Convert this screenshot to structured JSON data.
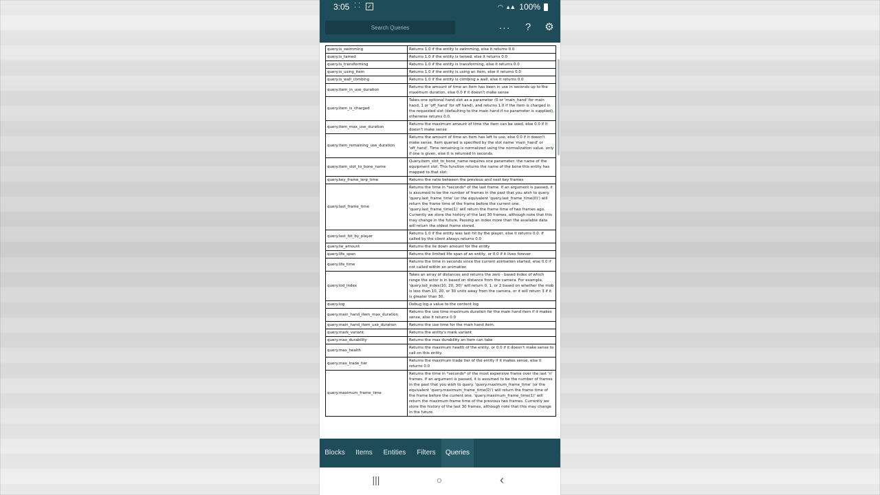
{
  "status_bar": {
    "time": "3:05",
    "dots": "⁚ ⁚",
    "battery": "100%",
    "icons": [
      "wifi-icon",
      "signal-icon",
      "battery-icon"
    ]
  },
  "app_bar": {
    "search_placeholder": "Search Queries",
    "icons": [
      "more-icon",
      "help-icon",
      "settings-icon"
    ]
  },
  "queries": [
    {
      "name": "query.is_swimming",
      "desc": "Returns 1.0 if the entity is swimming, else it returns 0.0"
    },
    {
      "name": "query.is_tamed",
      "desc": "Returns 1.0 if the entity is tamed, else it returns 0.0"
    },
    {
      "name": "query.is_transforming",
      "desc": "Returns 1.0 if the entity is transforming, else it returns 0.0"
    },
    {
      "name": "query.is_using_item",
      "desc": "Returns 1.0 if the entity is using an item, else it returns 0.0"
    },
    {
      "name": "query.is_wall_climbing",
      "desc": "Returns 1.0 if the entity is climbing a wall, else it returns 0.0"
    },
    {
      "name": "query.item_in_use_duration",
      "desc": "Returns the amount of time an item has been in use in seconds up to the maximum duration, else 0.0 if it doesn't make sense"
    },
    {
      "name": "query.item_is_charged",
      "desc": "Takes one optional hand slot as a parameter (0 or 'main_hand' for main hand, 1 or 'off_hand' for off hand), and returns 1.0 if the item is charged in the requested slot (defaulting to the main hand if no parameter is supplied), otherwise returns 0.0."
    },
    {
      "name": "query.item_max_use_duration",
      "desc": "Returns the maximum amount of time the item can be used, else 0.0 if it doesn't make sense"
    },
    {
      "name": "query.item_remaining_use_duration",
      "desc": "Returns the amount of time an item has left to use, else 0.0 if it doesn't make sense. Item queried is specified by the slot name 'main_hand' or 'off_hand'. Time remaining is normalized using the normalization value, only if one is given, else it is returned in seconds."
    },
    {
      "name": "query.item_slot_to_bone_name",
      "desc": "Query.item_slot_to_bone_name requires one parameter: the name of the equipment slot. This function returns the name of the bone this entity has mapped to that slot."
    },
    {
      "name": "query.key_frame_lerp_time",
      "desc": "Returns the ratio between the previous and next key frames"
    },
    {
      "name": "query.last_frame_time",
      "desc": "Returns the time in *seconds* of the last frame. If an argument is passed, it is assumed to be the number of frames in the past that you wish to query. 'query.last_frame_time' (or the equivalent 'query.last_frame_time(0)') will return the frame time of the frame before the current one. 'query.last_frame_time(1)' will return the frame time of two frames ago. Currently we store the history of the last 30 frames, although note that this may change in the future. Passing an index more than the available data will return the oldest frame stored."
    },
    {
      "name": "query.last_hit_by_player",
      "desc": "Returns 1.0 if the entity was last hit by the player, else it returns 0.0. If called by the client always returns 0.0"
    },
    {
      "name": "query.lie_amount",
      "desc": "Returns the lie down amount for the entity"
    },
    {
      "name": "query.life_span",
      "desc": "Returns the limited life span of an entity, or 0.0 if it lives forever"
    },
    {
      "name": "query.life_time",
      "desc": "Returns the time in seconds since the current animation started, else 0.0 if not called within an animation"
    },
    {
      "name": "query.lod_index",
      "desc": "Takes an array of distances and returns the zero - based index of which range the actor is in based on distance from the camera. For example, 'query.lod_index(10, 20, 30)' will return 0, 1, or 2 based on whether the mob is less than 10, 20, or 30 units away from the camera, or it will return 3 if it is greater than 30."
    },
    {
      "name": "query.log",
      "desc": "Debug log a value to the content log"
    },
    {
      "name": "query.main_hand_item_max_duration",
      "desc": "Returns the use time maximum duration for the main hand item if it makes sense, else it returns 0.0"
    },
    {
      "name": "query.main_hand_item_use_duration",
      "desc": "Returns the use time for the main hand item."
    },
    {
      "name": "query.mark_variant",
      "desc": "Returns the entity's mark variant"
    },
    {
      "name": "query.max_durability",
      "desc": "Returns the max durability an item can take"
    },
    {
      "name": "query.max_health",
      "desc": "Returns the maximum health of the entity, or 0.0 if it doesn't make sense to call on this entity."
    },
    {
      "name": "query.max_trade_tier",
      "desc": "Returns the maximum trade tier of the entity if it makes sense, else it returns 0.0"
    },
    {
      "name": "query.maximum_frame_time",
      "desc": "Returns the time in *seconds* of the most expensive frame over the last 'n' frames. If an argument is passed, it is assumed to be the number of frames in the past that you wish to query. 'query.maximum_frame_time' (or the equivalent 'query.maximum_frame_time(0)') will return the frame time of the frame before the current one. 'query.maximum_frame_time(1)' will return the maximum frame time of the previous two frames. Currently we store the history of the last 30 frames, although note that this may change in the future."
    }
  ],
  "bottom_nav": {
    "tabs": [
      "Blocks",
      "Items",
      "Entities",
      "Filters",
      "Queries"
    ],
    "active": "Queries"
  },
  "system_nav": {
    "recents": "|||",
    "home": "○",
    "back": "‹"
  }
}
